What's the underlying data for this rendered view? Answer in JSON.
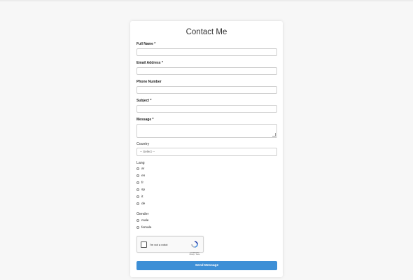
{
  "form": {
    "title": "Contact Me",
    "full_name_label": "Full Name *",
    "email_label": "Email Address *",
    "phone_label": "Phone Number",
    "subject_label": "Subject *",
    "message_label": "Message *",
    "country_label": "Country",
    "country_selected": "-- Select --",
    "lang_label": "Lang",
    "lang_options": [
      "ar",
      "en",
      "fr",
      "sp",
      "it",
      "de"
    ],
    "gender_label": "Gender",
    "gender_options": [
      "male",
      "female"
    ],
    "captcha_text": "I'm not a robot",
    "captcha_brand": "reCAPTCHA",
    "captcha_terms": "Privacy - Terms",
    "submit_label": "Send Message"
  },
  "colors": {
    "accent": "#3d8fd6",
    "background": "#f7f7f7",
    "card": "#ffffff"
  }
}
